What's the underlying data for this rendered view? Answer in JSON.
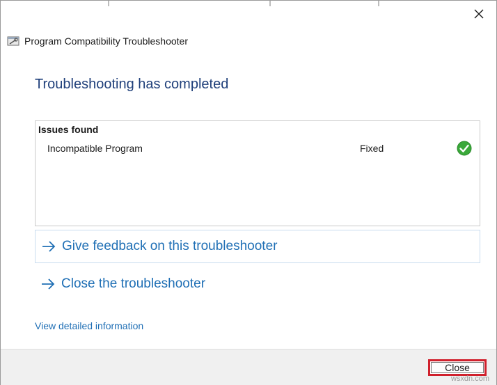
{
  "window": {
    "title": "Program Compatibility Troubleshooter",
    "close_icon": "close-icon"
  },
  "main": {
    "heading": "Troubleshooting has completed",
    "issues": {
      "header": "Issues found",
      "rows": [
        {
          "name": "Incompatible Program",
          "status": "Fixed",
          "status_icon": "green-check-icon"
        }
      ]
    },
    "links": [
      {
        "label": "Give feedback on this troubleshooter",
        "icon": "arrow-right-icon"
      },
      {
        "label": "Close the troubleshooter",
        "icon": "arrow-right-icon"
      }
    ],
    "detail_link": "View detailed information"
  },
  "footer": {
    "close_label": "Close"
  },
  "watermark": "wsxdn.com",
  "colors": {
    "heading": "#1f3f7a",
    "link": "#1f6fb5",
    "check": "#3aa83a",
    "highlight": "#d0202c"
  }
}
